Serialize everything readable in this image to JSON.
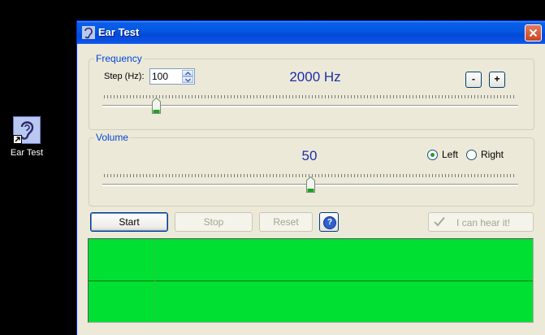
{
  "desktop": {
    "shortcut_label": "Ear Test",
    "shortcut_icon": "ear-icon"
  },
  "window": {
    "title": "Ear Test",
    "title_icon": "ear-icon",
    "close_icon": "close-icon"
  },
  "frequency": {
    "group_label": "Frequency",
    "step_label": "Step (Hz):",
    "step_value": "100",
    "display": "2000 Hz",
    "minus_label": "-",
    "plus_label": "+",
    "slider_fraction": 0.12
  },
  "volume": {
    "group_label": "Volume",
    "display": "50",
    "slider_fraction": 0.5,
    "channels": [
      {
        "label": "Left",
        "selected": true
      },
      {
        "label": "Right",
        "selected": false
      }
    ]
  },
  "controls": {
    "start_label": "Start",
    "stop_label": "Stop",
    "reset_label": "Reset",
    "help_icon": "help-icon",
    "hear_label": "I can hear it!",
    "hear_icon": "check-icon"
  },
  "colors": {
    "scope_bg": "#00e033",
    "value_text": "#1a2fa8",
    "group_label": "#0046d5"
  }
}
